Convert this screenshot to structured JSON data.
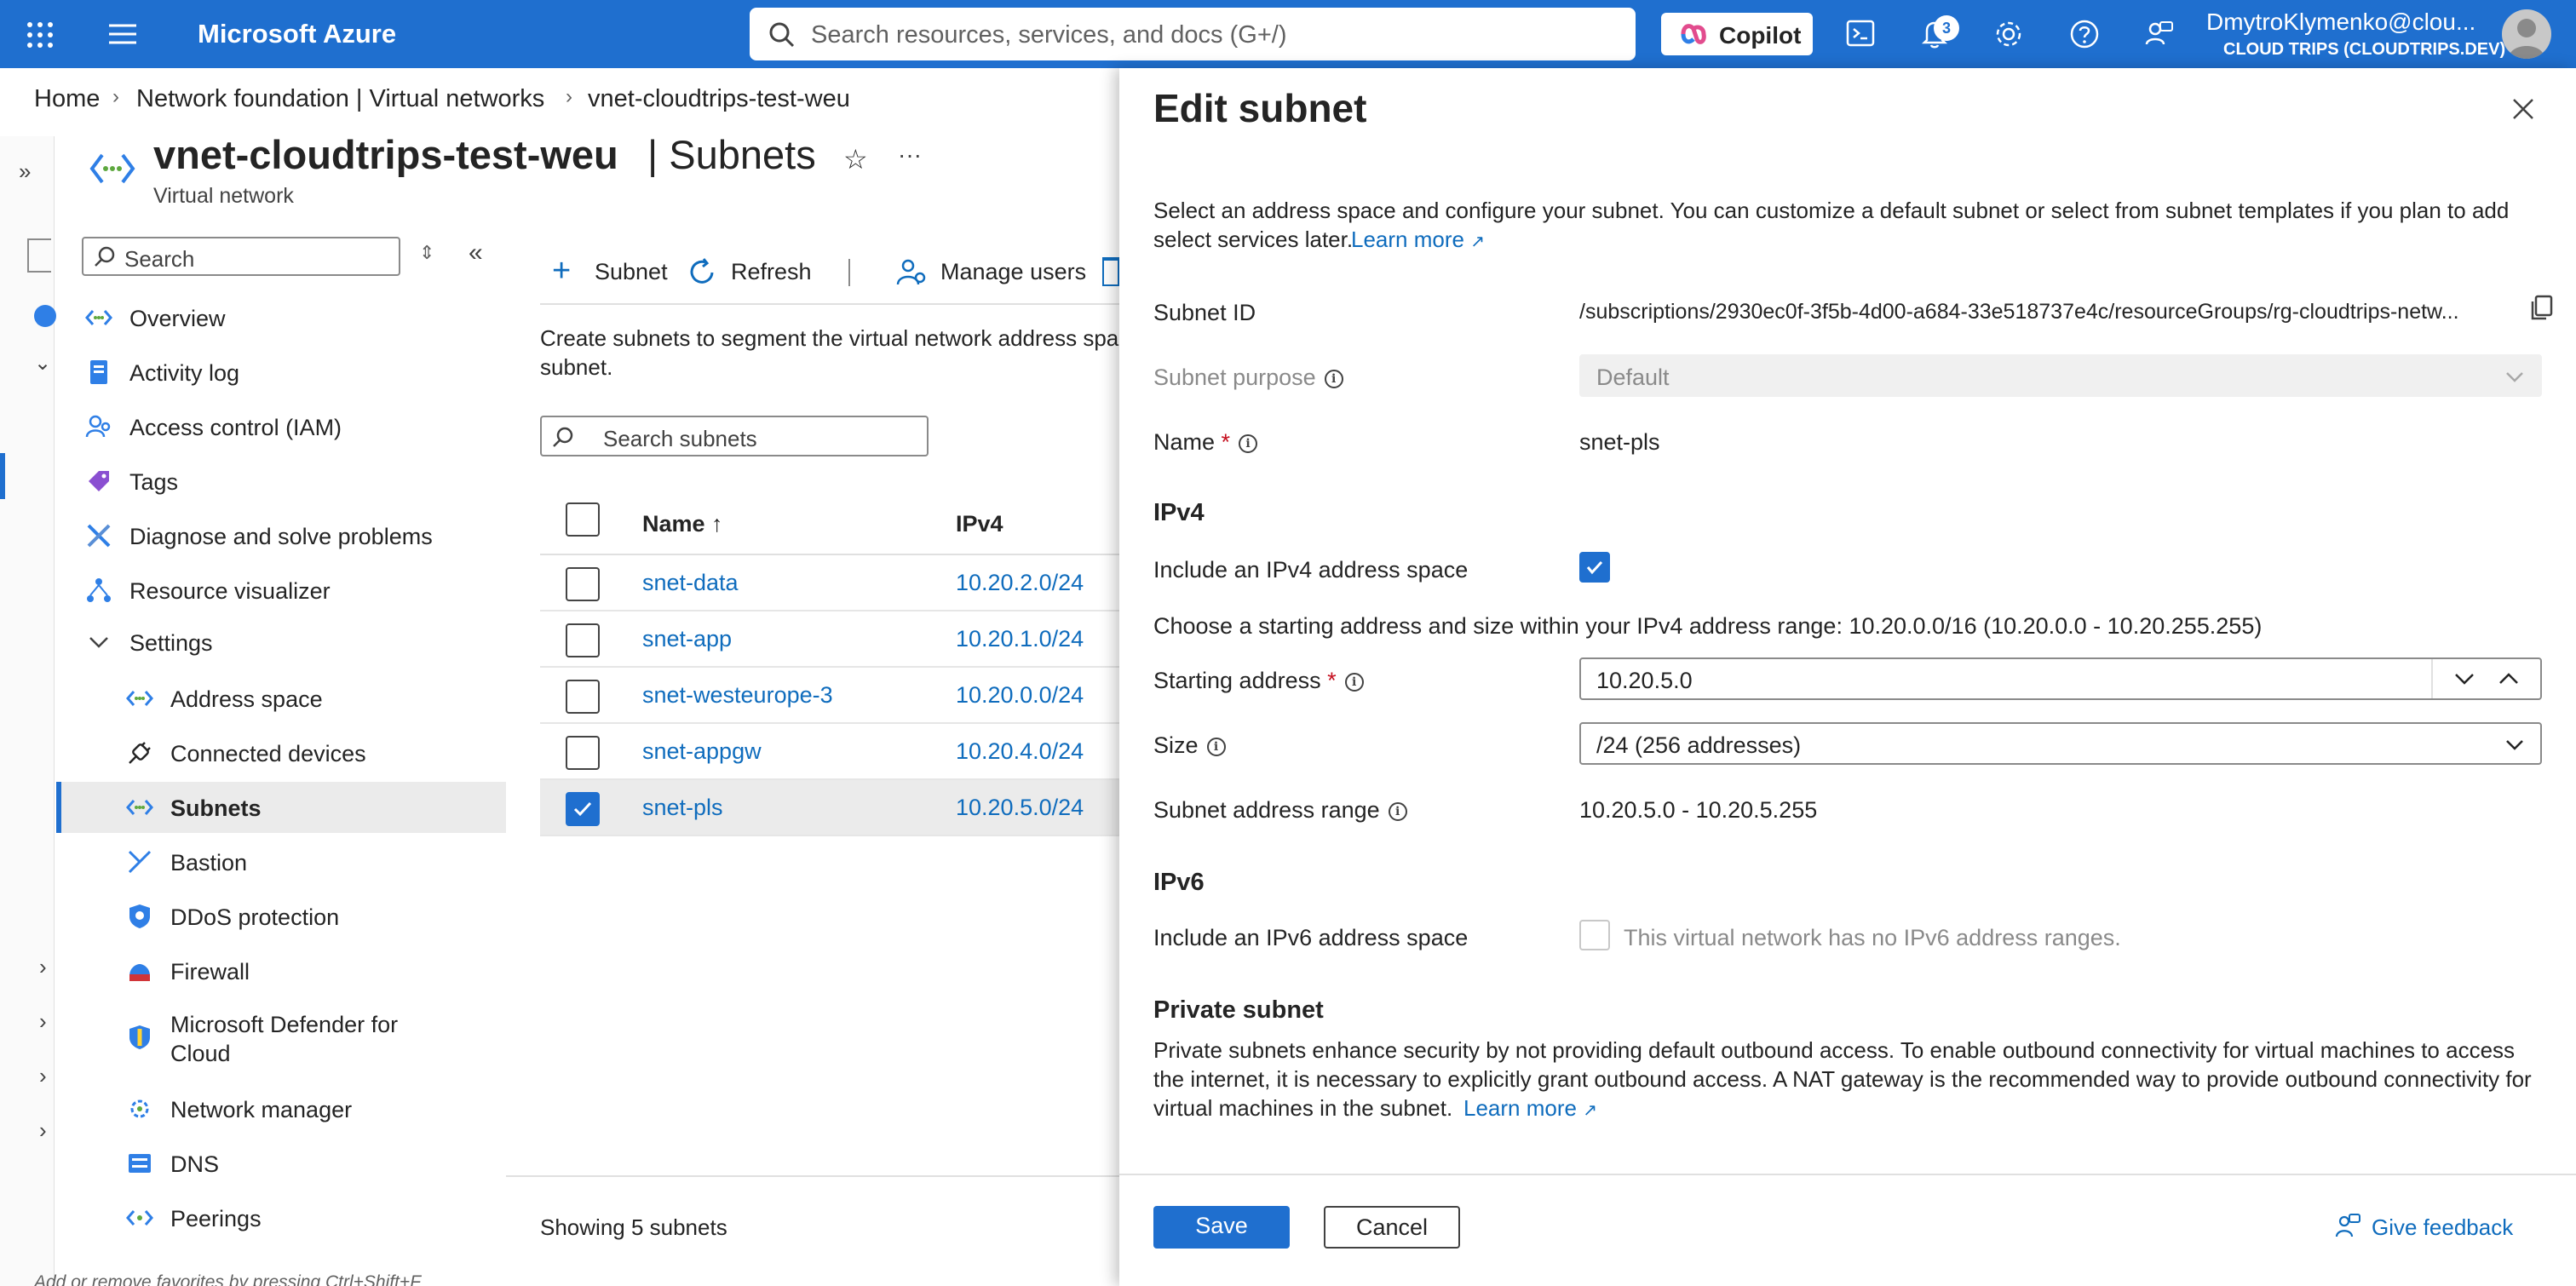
{
  "topbar": {
    "brand": "Microsoft Azure",
    "search_placeholder": "Search resources, services, and docs (G+/)",
    "copilot_label": "Copilot",
    "notification_count": "3",
    "user_email": "DmytroKlymenko@clou...",
    "user_tenant": "CLOUD TRIPS (CLOUDTRIPS.DEV)",
    "bg_color": "#1f6fcf"
  },
  "breadcrumb": [
    "Home",
    "Network foundation | Virtual networks",
    "vnet-cloudtrips-test-weu"
  ],
  "resource": {
    "name": "vnet-cloudtrips-test-weu",
    "section": "| Subnets",
    "type": "Virtual network"
  },
  "menu": {
    "search_placeholder": "Search",
    "items": [
      {
        "label": "Overview",
        "icon": "overview-icon"
      },
      {
        "label": "Activity log",
        "icon": "activity-log-icon"
      },
      {
        "label": "Access control (IAM)",
        "icon": "iam-icon"
      },
      {
        "label": "Tags",
        "icon": "tag-icon"
      },
      {
        "label": "Diagnose and solve problems",
        "icon": "wrench-icon"
      },
      {
        "label": "Resource visualizer",
        "icon": "visualizer-icon"
      },
      {
        "label": "Settings",
        "icon": "chevron-down-icon"
      },
      {
        "label": "Address space",
        "icon": "address-space-icon"
      },
      {
        "label": "Connected devices",
        "icon": "plug-icon"
      },
      {
        "label": "Subnets",
        "icon": "subnets-icon"
      },
      {
        "label": "Bastion",
        "icon": "bastion-icon"
      },
      {
        "label": "DDoS protection",
        "icon": "shield-icon"
      },
      {
        "label": "Firewall",
        "icon": "firewall-icon"
      },
      {
        "label": "Microsoft Defender for",
        "label2": "Cloud",
        "icon": "defender-icon"
      },
      {
        "label": "Network manager",
        "icon": "network-manager-icon"
      },
      {
        "label": "DNS",
        "icon": "dns-icon"
      },
      {
        "label": "Peerings",
        "icon": "peerings-icon"
      }
    ],
    "footer_hint": "Add or remove favorites by pressing Ctrl+Shift+F"
  },
  "toolbar": {
    "add_subnet": "Subnet",
    "refresh": "Refresh",
    "manage_users": "Manage users"
  },
  "subnets": {
    "description_line1": "Create subnets to segment the virtual network address spac",
    "description_line2": "subnet.",
    "search_placeholder": "Search subnets",
    "col_name": "Name ↑",
    "col_ipv4": "IPv4",
    "rows": [
      {
        "name": "snet-data",
        "ipv4": "10.20.2.0/24",
        "checked": false
      },
      {
        "name": "snet-app",
        "ipv4": "10.20.1.0/24",
        "checked": false
      },
      {
        "name": "snet-westeurope-3",
        "ipv4": "10.20.0.0/24",
        "checked": false
      },
      {
        "name": "snet-appgw",
        "ipv4": "10.20.4.0/24",
        "checked": false
      },
      {
        "name": "snet-pls",
        "ipv4": "10.20.5.0/24",
        "checked": true
      }
    ],
    "footer": "Showing 5 subnets"
  },
  "panel": {
    "title": "Edit subnet",
    "intro_line1": "Select an address space and configure your subnet. You can customize a default subnet or select from subnet templates if you plan to add",
    "intro_line2": "select services later.",
    "learn_more": "Learn more",
    "subnet_id_label": "Subnet ID",
    "subnet_id_value": "/subscriptions/2930ec0f-3f5b-4d00-a684-33e518737e4c/resourceGroups/rg-cloudtrips-netw...",
    "purpose_label": "Subnet purpose",
    "purpose_value": "Default",
    "name_label": "Name",
    "name_value": "snet-pls",
    "ipv4_heading": "IPv4",
    "include_ipv4_label": "Include an IPv4 address space",
    "include_ipv4_checked": true,
    "range_hint": "Choose a starting address and size within your IPv4 address range: 10.20.0.0/16 (10.20.0.0 - 10.20.255.255)",
    "starting_address_label": "Starting address",
    "starting_address_value": "10.20.5.0",
    "size_label": "Size",
    "size_value": "/24 (256 addresses)",
    "range_label": "Subnet address range",
    "range_value": "10.20.5.0 - 10.20.5.255",
    "ipv6_heading": "IPv6",
    "include_ipv6_label": "Include an IPv6 address space",
    "ipv6_note": "This virtual network has no IPv6 address ranges.",
    "private_heading": "Private subnet",
    "private_line1": "Private subnets enhance security by not providing default outbound access. To enable outbound connectivity for virtual machines to access",
    "private_line2": "the internet, it is necessary to explicitly grant outbound access. A NAT gateway is the recommended way to provide outbound connectivity for",
    "private_line3": "virtual machines in the subnet.",
    "save": "Save",
    "cancel": "Cancel",
    "feedback": "Give feedback"
  }
}
